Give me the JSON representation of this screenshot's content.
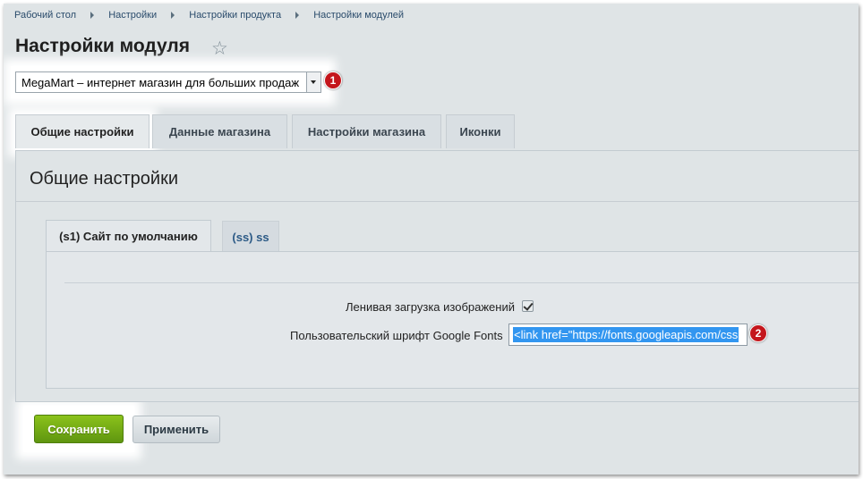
{
  "breadcrumb": [
    "Рабочий стол",
    "Настройки",
    "Настройки продукта",
    "Настройки модулей"
  ],
  "page_title": "Настройки модуля",
  "module_select": {
    "value": "MegaMart – интернет магазин для больших продаж"
  },
  "badges": [
    "1",
    "2"
  ],
  "tabs": [
    {
      "label": "Общие настройки",
      "active": true
    },
    {
      "label": "Данные магазина"
    },
    {
      "label": "Настройки магазина"
    },
    {
      "label": "Иконки"
    }
  ],
  "panel_title": "Общие настройки",
  "site_tabs": [
    {
      "label": "(s1) Сайт по умолчанию",
      "active": true
    },
    {
      "label": "(ss) ss"
    }
  ],
  "fields": {
    "lazy_load": {
      "label": "Ленивая загрузка изображений",
      "checked": true
    },
    "google_fonts": {
      "label": "Пользовательский шрифт Google Fonts",
      "value": "<link href=\"https://fonts.googleapis.com/css"
    }
  },
  "buttons": {
    "save": "Сохранить",
    "apply": "Применить"
  },
  "colors": {
    "save_button": "#7ab317",
    "badge": "#c4161c",
    "selection": "#3296f0"
  },
  "icons": [
    "star-icon",
    "chevron-down-icon",
    "checkbox-checked-icon"
  ]
}
